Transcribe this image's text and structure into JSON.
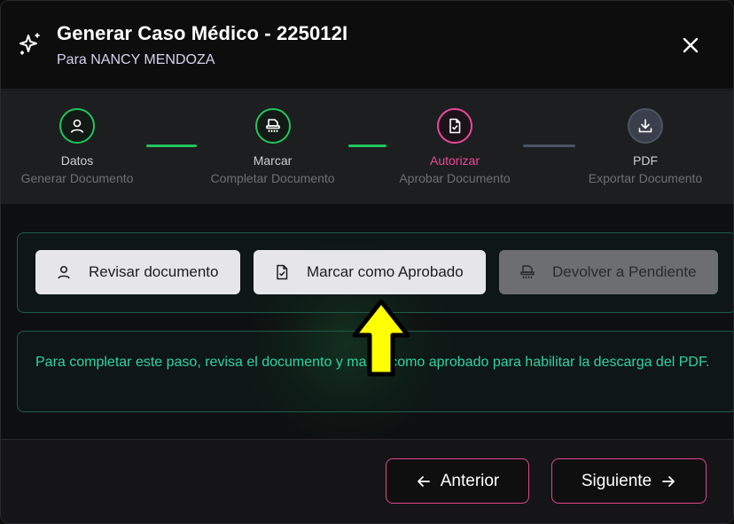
{
  "header": {
    "title": "Generar Caso Médico - 225012I",
    "subtitle": "Para NANCY MENDOZA",
    "icon": "sparkles-icon"
  },
  "steps": [
    {
      "label": "Datos",
      "sub": "Generar Documento",
      "status": "done",
      "icon": "user-icon"
    },
    {
      "label": "Marcar",
      "sub": "Completar Documento",
      "status": "done",
      "icon": "stamp-icon"
    },
    {
      "label": "Autorizar",
      "sub": "Aprobar Documento",
      "status": "active",
      "icon": "file-check-icon"
    },
    {
      "label": "PDF",
      "sub": "Exportar Documento",
      "status": "todo",
      "icon": "download-icon"
    }
  ],
  "actions": {
    "review": "Revisar documento",
    "approve": "Marcar como Aprobado",
    "revert": "Devolver a Pendiente"
  },
  "info": "Para completar este paso, revisa el documento y marca como aprobado para habilitar la descarga del PDF.",
  "footer": {
    "prev": "Anterior",
    "next": "Siguiente"
  },
  "colors": {
    "done": "#22c55e",
    "active": "#ec4899",
    "todo": "#4b5563",
    "info_text": "#2dd4a4",
    "arrow": "#ffff00"
  }
}
